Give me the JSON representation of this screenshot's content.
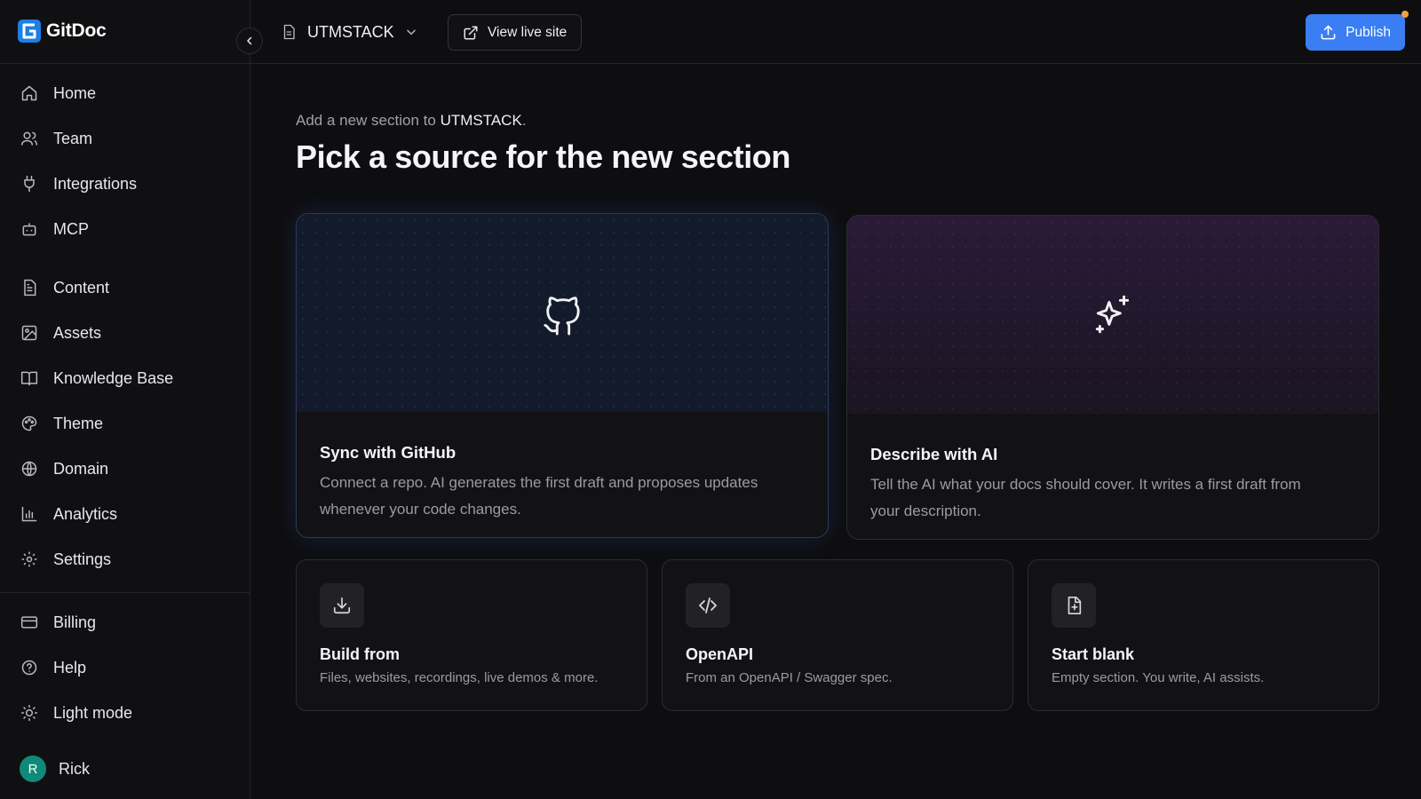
{
  "app": {
    "name": "GitDoc"
  },
  "sidebar": {
    "primary": [
      {
        "label": "Home",
        "icon": "home-icon"
      },
      {
        "label": "Team",
        "icon": "users-icon"
      },
      {
        "label": "Integrations",
        "icon": "plug-icon"
      },
      {
        "label": "MCP",
        "icon": "robot-icon"
      }
    ],
    "content": [
      {
        "label": "Content",
        "icon": "file-text-icon"
      },
      {
        "label": "Assets",
        "icon": "image-icon"
      },
      {
        "label": "Knowledge Base",
        "icon": "book-icon"
      },
      {
        "label": "Theme",
        "icon": "palette-icon"
      },
      {
        "label": "Domain",
        "icon": "globe-icon"
      },
      {
        "label": "Analytics",
        "icon": "bar-chart-icon"
      },
      {
        "label": "Settings",
        "icon": "gear-icon"
      }
    ],
    "bottom": [
      {
        "label": "Billing",
        "icon": "credit-card-icon"
      },
      {
        "label": "Help",
        "icon": "help-circle-icon"
      },
      {
        "label": "Light mode",
        "icon": "sun-icon"
      }
    ],
    "user": {
      "initial": "R",
      "name": "Rick"
    }
  },
  "topbar": {
    "project": "UTMSTACK",
    "view_live_label": "View live site",
    "publish_label": "Publish"
  },
  "main": {
    "subtitle_prefix": "Add a new section to",
    "subtitle_project": "UTMSTACK",
    "subtitle_suffix": ".",
    "title": "Pick a source for the new section",
    "big_cards": [
      {
        "title": "Sync with GitHub",
        "desc": "Connect a repo. AI generates the first draft and proposes updates whenever your code changes.",
        "icon": "github-icon"
      },
      {
        "title": "Describe with AI",
        "desc": "Tell the AI what your docs should cover. It writes a first draft from your description.",
        "icon": "sparkles-icon"
      }
    ],
    "small_cards": [
      {
        "title": "Build from",
        "desc": "Files, websites, recordings, live demos & more.",
        "icon": "download-icon"
      },
      {
        "title": "OpenAPI",
        "desc": "From an OpenAPI / Swagger spec.",
        "icon": "code-icon"
      },
      {
        "title": "Start blank",
        "desc": "Empty section. You write, AI assists.",
        "icon": "file-plus-icon"
      }
    ]
  },
  "colors": {
    "background": "#0e0e10",
    "accent": "#3b7df2",
    "avatar": "#0f8a7a",
    "publish_badge": "#f2a23b"
  }
}
